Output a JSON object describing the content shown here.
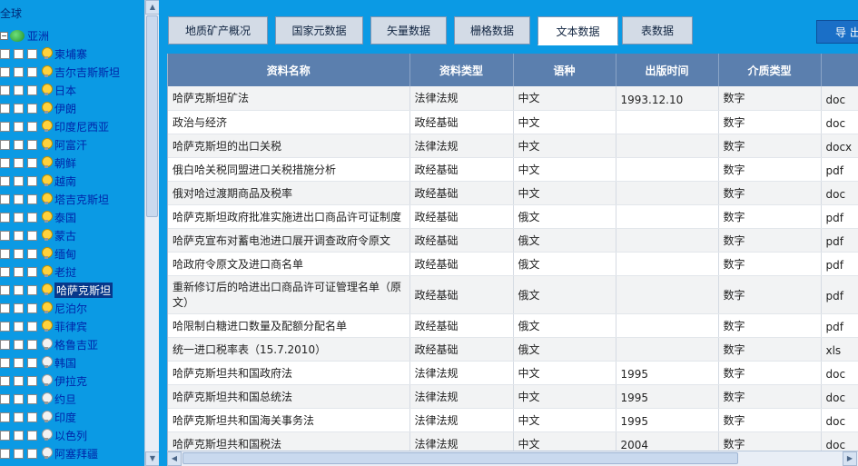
{
  "tree": {
    "root": "全球",
    "asia": "亚洲",
    "items": [
      {
        "label": "柬埔寨",
        "on": true
      },
      {
        "label": "吉尔吉斯斯坦",
        "on": true
      },
      {
        "label": "日本",
        "on": true
      },
      {
        "label": "伊朗",
        "on": true
      },
      {
        "label": "印度尼西亚",
        "on": true
      },
      {
        "label": "阿富汗",
        "on": true
      },
      {
        "label": "朝鲜",
        "on": true
      },
      {
        "label": "越南",
        "on": true
      },
      {
        "label": "塔吉克斯坦",
        "on": true
      },
      {
        "label": "泰国",
        "on": true
      },
      {
        "label": "蒙古",
        "on": true
      },
      {
        "label": "缅甸",
        "on": true
      },
      {
        "label": "老挝",
        "on": true
      },
      {
        "label": "哈萨克斯坦",
        "on": true,
        "selected": true
      },
      {
        "label": "尼泊尔",
        "on": true
      },
      {
        "label": "菲律宾",
        "on": true
      },
      {
        "label": "格鲁吉亚",
        "on": false
      },
      {
        "label": "韩国",
        "on": false
      },
      {
        "label": "伊拉克",
        "on": false
      },
      {
        "label": "约旦",
        "on": false
      },
      {
        "label": "印度",
        "on": false
      },
      {
        "label": "以色列",
        "on": false
      },
      {
        "label": "阿塞拜疆",
        "on": false
      }
    ]
  },
  "tabs": [
    {
      "label": "地质矿产概况"
    },
    {
      "label": "国家元数据"
    },
    {
      "label": "矢量数据"
    },
    {
      "label": "栅格数据"
    },
    {
      "label": "文本数据",
      "active": true
    },
    {
      "label": "表数据"
    }
  ],
  "export_label": "导 出",
  "grid": {
    "columns": [
      "资料名称",
      "资料类型",
      "语种",
      "出版时间",
      "介质类型",
      ""
    ],
    "rows": [
      [
        "哈萨克斯坦矿法",
        "法律法规",
        "中文",
        "1993.12.10",
        "数字",
        "doc"
      ],
      [
        "政治与经济",
        "政经基础",
        "中文",
        "",
        "数字",
        "doc"
      ],
      [
        "哈萨克斯坦的出口关税",
        "法律法规",
        "中文",
        "",
        "数字",
        "docx"
      ],
      [
        "俄白哈关税同盟进口关税措施分析",
        "政经基础",
        "中文",
        "",
        "数字",
        "pdf"
      ],
      [
        "俄对哈过渡期商品及税率",
        "政经基础",
        "中文",
        "",
        "数字",
        "doc"
      ],
      [
        "哈萨克斯坦政府批准实施进出口商品许可证制度",
        "政经基础",
        "俄文",
        "",
        "数字",
        "pdf"
      ],
      [
        "哈萨克宣布对蓄电池进口展开调查政府令原文",
        "政经基础",
        "俄文",
        "",
        "数字",
        "pdf"
      ],
      [
        "哈政府令原文及进口商名单",
        "政经基础",
        "俄文",
        "",
        "数字",
        "pdf"
      ],
      [
        "重新修订后的哈进出口商品许可证管理名单（原文）",
        "政经基础",
        "俄文",
        "",
        "数字",
        "pdf"
      ],
      [
        "哈限制白糖进口数量及配额分配名单",
        "政经基础",
        "俄文",
        "",
        "数字",
        "pdf"
      ],
      [
        "统一进口税率表（15.7.2010）",
        "政经基础",
        "俄文",
        "",
        "数字",
        "xls"
      ],
      [
        "哈萨克斯坦共和国政府法",
        "法律法规",
        "中文",
        "1995",
        "数字",
        "doc"
      ],
      [
        "哈萨克斯坦共和国总统法",
        "法律法规",
        "中文",
        "1995",
        "数字",
        "doc"
      ],
      [
        "哈萨克斯坦共和国海关事务法",
        "法律法规",
        "中文",
        "1995",
        "数字",
        "doc"
      ],
      [
        "哈萨克斯坦共和国税法",
        "法律法规",
        "中文",
        "2004",
        "数字",
        "doc"
      ]
    ]
  }
}
